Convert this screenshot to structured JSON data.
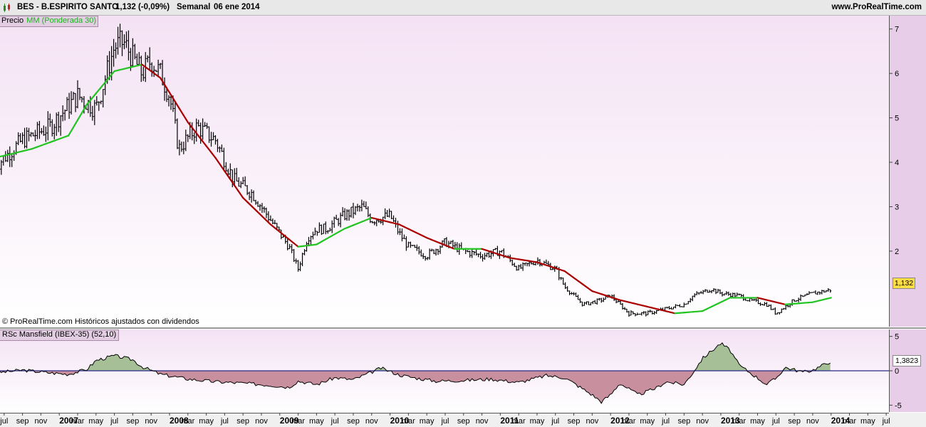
{
  "header": {
    "symbol_title": "BES - B.ESPIRITO SANTO",
    "last_value": "1,132 (-0,09%)",
    "period": "Semanal",
    "date": "06 ene 2014",
    "site": "www.ProRealTime.com"
  },
  "legend": {
    "price": "Precio",
    "ma": "MM (Ponderada 30)"
  },
  "copyright": "© ProRealTime.com  Históricos ajustados con dividendos",
  "price_tag": "1,132",
  "rsc": {
    "label": "RSc Mansfield (IBEX-35) (52,10)",
    "value_tag": "1,3823",
    "ticks": [
      "5",
      "0",
      "-5"
    ]
  },
  "colors": {
    "background_top": "#f4e2f4",
    "background_bottom": "#ffffff",
    "price_bars": "#000000",
    "ma_up": "#22c422",
    "ma_down": "#aa0000",
    "rsc_positive_fill": "#a6bf96",
    "rsc_negative_fill": "#c8909e",
    "axis_panel": "#e8cde8"
  },
  "chart_data": [
    {
      "type": "line",
      "subtype": "ohlc-bars",
      "title": "BES - B.ESPIRITO SANTO",
      "ylim": [
        0.3,
        7.3
      ],
      "y_ticks": [
        7,
        6,
        5,
        4,
        3,
        2
      ],
      "x_ticks": [
        "jul",
        "sep",
        "nov",
        "2007",
        "mar",
        "may",
        "jul",
        "sep",
        "nov",
        "2008",
        "mar",
        "may",
        "jul",
        "sep",
        "nov",
        "2009",
        "mar",
        "may",
        "jul",
        "sep",
        "nov",
        "2010",
        "mar",
        "may",
        "jul",
        "sep",
        "nov",
        "2011",
        "mar",
        "may",
        "jul",
        "sep",
        "nov",
        "2012",
        "mar",
        "may",
        "jul",
        "sep",
        "nov",
        "2013",
        "mar",
        "may",
        "jul",
        "sep",
        "nov",
        "2014",
        "mar",
        "may",
        "jul"
      ],
      "x_range": [
        "2006-06",
        "2014-07"
      ],
      "series": [
        {
          "name": "Precio",
          "x": [
            "2006-06",
            "2006-09",
            "2006-12",
            "2007-03",
            "2007-05",
            "2007-07",
            "2007-08",
            "2007-10",
            "2007-11",
            "2007-12",
            "2008-01",
            "2008-02",
            "2008-04",
            "2008-06",
            "2008-08",
            "2008-10",
            "2008-12",
            "2009-02",
            "2009-03",
            "2009-04",
            "2009-05",
            "2009-06",
            "2009-08",
            "2009-10",
            "2009-11",
            "2010-01",
            "2010-02",
            "2010-03",
            "2010-05",
            "2010-07",
            "2010-09",
            "2010-11",
            "2011-01",
            "2011-03",
            "2011-05",
            "2011-07",
            "2011-08",
            "2011-10",
            "2011-12",
            "2012-01",
            "2012-03",
            "2012-05",
            "2012-07",
            "2012-09",
            "2012-10",
            "2012-12",
            "2013-01",
            "2013-03",
            "2013-04",
            "2013-06",
            "2013-07",
            "2013-09",
            "2013-11",
            "2014-01"
          ],
          "values": [
            3.9,
            4.5,
            4.8,
            5.5,
            5.2,
            6.6,
            6.7,
            6.0,
            6.3,
            6.0,
            5.5,
            4.3,
            4.8,
            4.5,
            3.6,
            3.3,
            2.7,
            2.1,
            1.6,
            2.3,
            2.5,
            2.5,
            2.8,
            3.0,
            2.7,
            2.8,
            2.4,
            2.1,
            1.9,
            2.2,
            2.0,
            1.9,
            2.0,
            1.6,
            1.8,
            1.6,
            1.2,
            0.8,
            0.9,
            1.0,
            0.6,
            0.6,
            0.7,
            0.8,
            1.0,
            1.15,
            1.05,
            1.0,
            0.9,
            0.8,
            0.6,
            0.9,
            1.05,
            1.13
          ]
        },
        {
          "name": "MM (Ponderada 30)",
          "x": [
            "2006-06",
            "2006-10",
            "2007-02",
            "2007-04",
            "2007-07",
            "2007-10",
            "2007-12",
            "2008-03",
            "2008-06",
            "2008-09",
            "2008-12",
            "2009-03",
            "2009-05",
            "2009-08",
            "2009-11",
            "2010-02",
            "2010-05",
            "2010-08",
            "2010-11",
            "2011-02",
            "2011-05",
            "2011-08",
            "2011-11",
            "2012-02",
            "2012-05",
            "2012-08",
            "2012-11",
            "2013-02",
            "2013-05",
            "2013-08",
            "2013-11",
            "2014-01"
          ],
          "values": [
            4.1,
            4.3,
            4.6,
            5.3,
            6.05,
            6.2,
            5.9,
            4.9,
            4.1,
            3.2,
            2.6,
            2.1,
            2.15,
            2.5,
            2.75,
            2.6,
            2.3,
            2.05,
            2.05,
            1.85,
            1.75,
            1.55,
            1.1,
            0.9,
            0.75,
            0.6,
            0.65,
            0.95,
            0.95,
            0.8,
            0.85,
            0.95
          ]
        }
      ]
    },
    {
      "type": "area",
      "title": "RSc Mansfield (IBEX-35) (52,10)",
      "ylim": [
        -6,
        6
      ],
      "y_ticks": [
        5,
        0,
        -5
      ],
      "series": [
        {
          "name": "RSc Mansfield (IBEX-35) (52,10)",
          "x": [
            "2006-06",
            "2006-09",
            "2006-12",
            "2007-02",
            "2007-04",
            "2007-05",
            "2007-07",
            "2007-09",
            "2007-10",
            "2007-12",
            "2008-03",
            "2008-06",
            "2008-09",
            "2008-12",
            "2009-02",
            "2009-03",
            "2009-05",
            "2009-07",
            "2009-09",
            "2009-11",
            "2009-12",
            "2010-02",
            "2010-04",
            "2010-06",
            "2010-09",
            "2010-12",
            "2011-03",
            "2011-06",
            "2011-08",
            "2011-09",
            "2011-11",
            "2011-12",
            "2012-01",
            "2012-02",
            "2012-04",
            "2012-06",
            "2012-07",
            "2012-09",
            "2012-10",
            "2012-11",
            "2013-01",
            "2013-02",
            "2013-03",
            "2013-04",
            "2013-06",
            "2013-07",
            "2013-08",
            "2013-10",
            "2013-11",
            "2014-01"
          ],
          "values": [
            -0.3,
            0.1,
            -0.3,
            -0.5,
            0.2,
            1.5,
            2.2,
            1.6,
            0.6,
            -0.5,
            -1.2,
            -1.6,
            -1.8,
            -2.1,
            -2.4,
            -1.5,
            -2.0,
            -1.0,
            -1.3,
            -0.2,
            0.4,
            -0.6,
            -1.1,
            -1.5,
            -1.4,
            -1.2,
            -1.7,
            -0.7,
            -1.0,
            -1.8,
            -3.5,
            -4.5,
            -3.5,
            -1.8,
            -3.5,
            -2.5,
            -1.6,
            -2.0,
            -0.2,
            1.8,
            4.0,
            3.0,
            0.8,
            -0.1,
            -2.0,
            -1.1,
            0.5,
            -0.2,
            0.1,
            1.4
          ]
        }
      ]
    }
  ]
}
